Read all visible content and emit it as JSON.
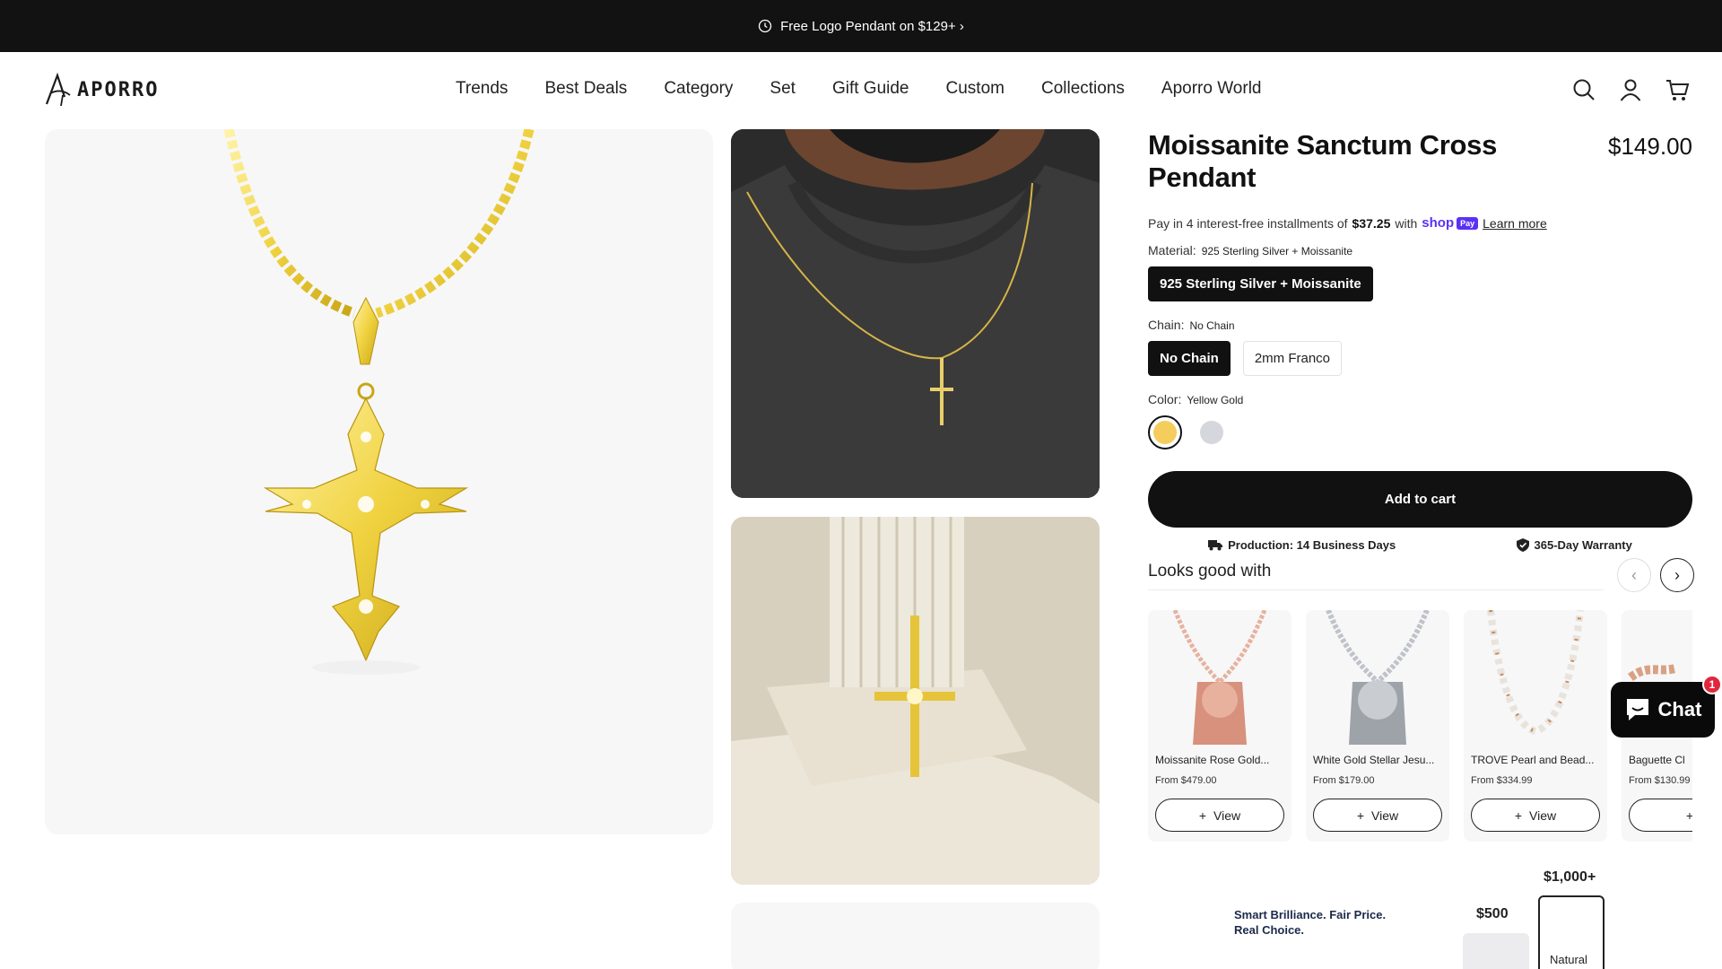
{
  "announcement": {
    "text": "Free Logo Pendant on $129+ ›"
  },
  "brand": {
    "name": "APORRO"
  },
  "nav": [
    "Trends",
    "Best Deals",
    "Category",
    "Set",
    "Gift Guide",
    "Custom",
    "Collections",
    "Aporro World"
  ],
  "header_icons": [
    "search-icon",
    "account-icon",
    "cart-icon"
  ],
  "product": {
    "title": "Moissanite Sanctum Cross Pendant",
    "price": "$149.00",
    "installment": {
      "prefix": "Pay in 4 interest-free installments of",
      "amount": "$37.25",
      "with": "with",
      "shop_label": "shop",
      "pay_label": "Pay",
      "learn_more": "Learn more"
    },
    "material": {
      "label": "Material:",
      "value": "925 Sterling Silver + Moissanite",
      "options": [
        "925 Sterling Silver + Moissanite"
      ]
    },
    "chain": {
      "label": "Chain:",
      "value": "No Chain",
      "options": [
        "No Chain",
        "2mm Franco"
      ]
    },
    "color": {
      "label": "Color:",
      "value": "Yellow Gold",
      "swatches": [
        "#f4cd5c",
        "#d5d7dc"
      ]
    },
    "add_to_cart": "Add to cart",
    "perks": [
      "Production: 14 Business Days",
      "365-Day Warranty"
    ]
  },
  "looks_good_with": {
    "title": "Looks good with",
    "items": [
      {
        "name": "Moissanite Rose Gold...",
        "price": "From $479.00",
        "view": "View"
      },
      {
        "name": "White Gold Stellar Jesu...",
        "price": "From $179.00",
        "view": "View"
      },
      {
        "name": "TROVE Pearl and Bead...",
        "price": "From $334.99",
        "view": "View"
      },
      {
        "name": "Baguette Cl",
        "price": "From $130.99",
        "view": ""
      }
    ]
  },
  "chat": {
    "label": "Chat",
    "badge": "1"
  },
  "compare": {
    "tagline_1": "Smart Brilliance. Fair Price.",
    "tagline_2": "Real Choice.",
    "price_low": "$500",
    "price_high": "$1,000+",
    "natural": "Natural"
  }
}
